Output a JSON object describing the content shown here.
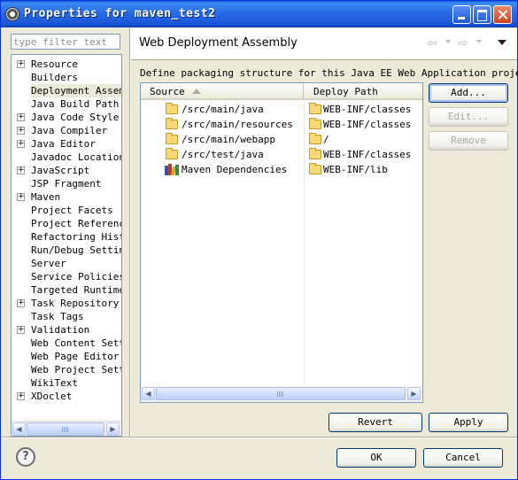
{
  "window": {
    "title": "Properties for maven_test2"
  },
  "filter": {
    "placeholder": "type filter text"
  },
  "tree": {
    "items": [
      {
        "label": "Resource",
        "expandable": true
      },
      {
        "label": "Builders",
        "expandable": false
      },
      {
        "label": "Deployment Assembly",
        "expandable": false,
        "selected": true
      },
      {
        "label": "Java Build Path",
        "expandable": false
      },
      {
        "label": "Java Code Style",
        "expandable": true
      },
      {
        "label": "Java Compiler",
        "expandable": true
      },
      {
        "label": "Java Editor",
        "expandable": true
      },
      {
        "label": "Javadoc Location",
        "expandable": false
      },
      {
        "label": "JavaScript",
        "expandable": true
      },
      {
        "label": "JSP Fragment",
        "expandable": false
      },
      {
        "label": "Maven",
        "expandable": true
      },
      {
        "label": "Project Facets",
        "expandable": false
      },
      {
        "label": "Project References",
        "expandable": false
      },
      {
        "label": "Refactoring History",
        "expandable": false
      },
      {
        "label": "Run/Debug Settings",
        "expandable": false
      },
      {
        "label": "Server",
        "expandable": false
      },
      {
        "label": "Service Policies",
        "expandable": false
      },
      {
        "label": "Targeted Runtimes",
        "expandable": false
      },
      {
        "label": "Task Repository",
        "expandable": true
      },
      {
        "label": "Task Tags",
        "expandable": false
      },
      {
        "label": "Validation",
        "expandable": true
      },
      {
        "label": "Web Content Settings",
        "expandable": false
      },
      {
        "label": "Web Page Editor",
        "expandable": false
      },
      {
        "label": "Web Project Settings",
        "expandable": false
      },
      {
        "label": "WikiText",
        "expandable": false
      },
      {
        "label": "XDoclet",
        "expandable": true
      }
    ],
    "expand_glyph": "+"
  },
  "page": {
    "title": "Web Deployment Assembly",
    "description": "Define packaging structure for this Java EE Web Application project.",
    "back_icon": "⇦",
    "forward_icon": "⇨"
  },
  "table": {
    "headers": {
      "source": "Source",
      "deploy": "Deploy Path"
    },
    "rows": [
      {
        "source": "/src/main/java",
        "deploy": "WEB-INF/classes",
        "icon": "folder-icon"
      },
      {
        "source": "/src/main/resources",
        "deploy": "WEB-INF/classes",
        "icon": "folder-icon"
      },
      {
        "source": "/src/main/webapp",
        "deploy": "/",
        "icon": "folder-icon"
      },
      {
        "source": "/src/test/java",
        "deploy": "WEB-INF/classes",
        "icon": "folder-icon"
      },
      {
        "source": "Maven Dependencies",
        "deploy": "WEB-INF/lib",
        "icon": "library-icon"
      }
    ]
  },
  "buttons": {
    "add": "Add...",
    "edit": "Edit...",
    "remove": "Remove",
    "revert": "Revert",
    "apply": "Apply",
    "ok": "OK",
    "cancel": "Cancel",
    "help": "?"
  },
  "scroll": {
    "left": "◀",
    "right": "▶"
  }
}
